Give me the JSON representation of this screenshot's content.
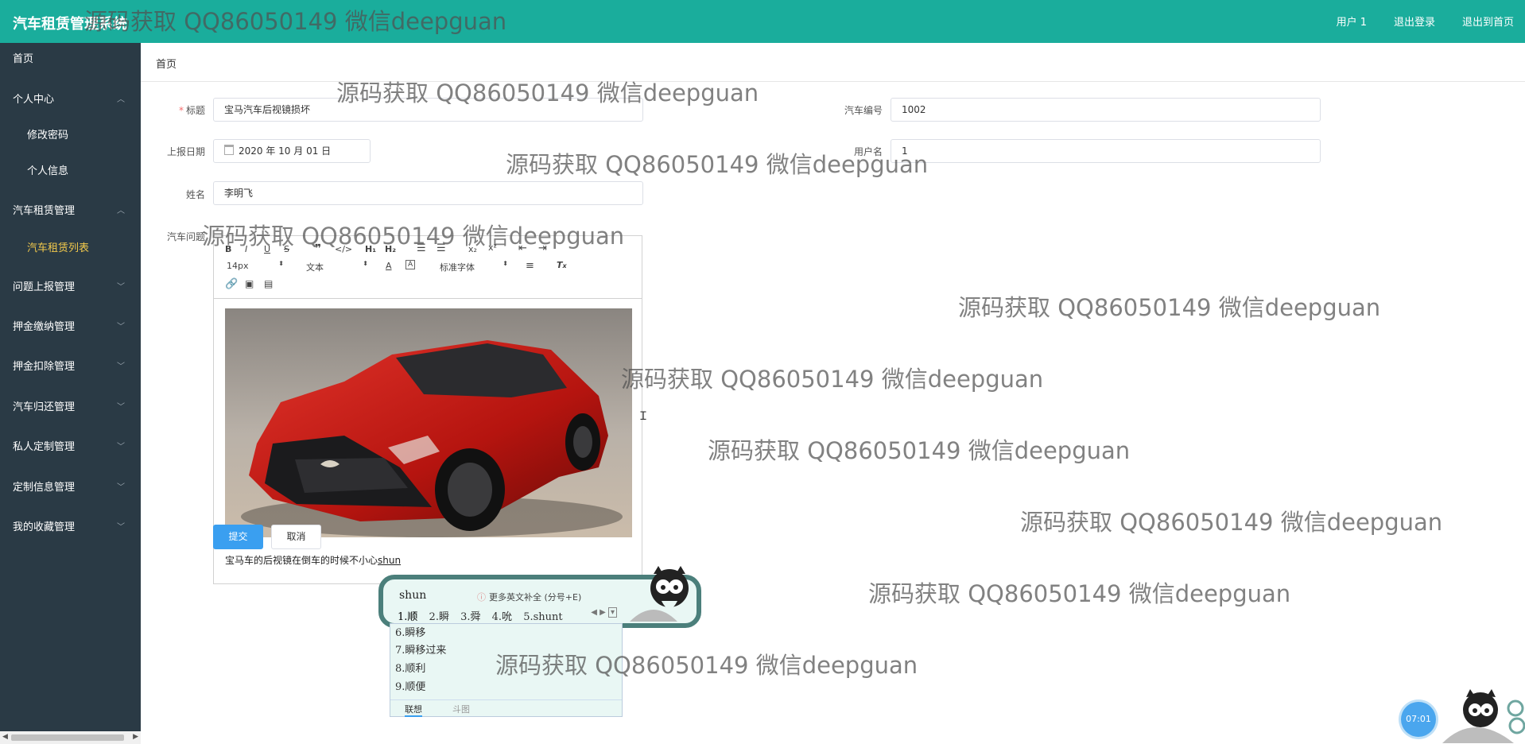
{
  "header": {
    "app_title": "汽车租赁管理系统",
    "links": [
      "用户 1",
      "退出登录",
      "退出到首页"
    ]
  },
  "sidebar": {
    "items": [
      {
        "label": "首页",
        "chevron": ""
      },
      {
        "label": "个人中心",
        "chevron": "up"
      },
      {
        "label": "修改密码",
        "sub": true
      },
      {
        "label": "个人信息",
        "sub": true
      },
      {
        "label": "汽车租赁管理",
        "chevron": "up"
      },
      {
        "label": "汽车租赁列表",
        "sub": true,
        "active": true
      },
      {
        "label": "问题上报管理",
        "chevron": "down"
      },
      {
        "label": "押金缴纳管理",
        "chevron": "down"
      },
      {
        "label": "押金扣除管理",
        "chevron": "down"
      },
      {
        "label": "汽车归还管理",
        "chevron": "down"
      },
      {
        "label": "私人定制管理",
        "chevron": "down"
      },
      {
        "label": "定制信息管理",
        "chevron": "down"
      },
      {
        "label": "我的收藏管理",
        "chevron": "down"
      }
    ]
  },
  "breadcrumb": "首页",
  "form": {
    "title_label": "标题",
    "title_value": "宝马汽车后视镜损坏",
    "car_no_label": "汽车编号",
    "car_no_value": "1002",
    "date_label": "上报日期",
    "date_value": "2020 年 10 月 01 日",
    "username_label": "用户名",
    "username_value": "1",
    "name_label": "姓名",
    "name_value": "李明飞",
    "issue_label": "汽车问题"
  },
  "editor": {
    "font_size": "14px",
    "block_format": "文本",
    "font_family": "标准字体",
    "text_before": "宝马车的后视镜在倒车的时候不小心",
    "text_composing": "shun"
  },
  "buttons": {
    "submit": "提交",
    "cancel": "取消"
  },
  "ime": {
    "composition": "shun",
    "hint": "更多英文补全 (分号+E)",
    "candidates": [
      "1.顺",
      "2.瞬",
      "3.舜",
      "4.吮",
      "5.shunt"
    ],
    "more": [
      "6.瞬移",
      "7.瞬移过来",
      "8.顺利",
      "9.顺便"
    ],
    "tabs": [
      "联想",
      "斗图"
    ]
  },
  "clock": "07:01",
  "colors": {
    "header": "#1aad9c",
    "sidebar": "#2a3a45",
    "active": "#f2c94c",
    "primary": "#3a9ff0"
  },
  "watermark": "源码获取 QQ86050149 微信deepguan"
}
